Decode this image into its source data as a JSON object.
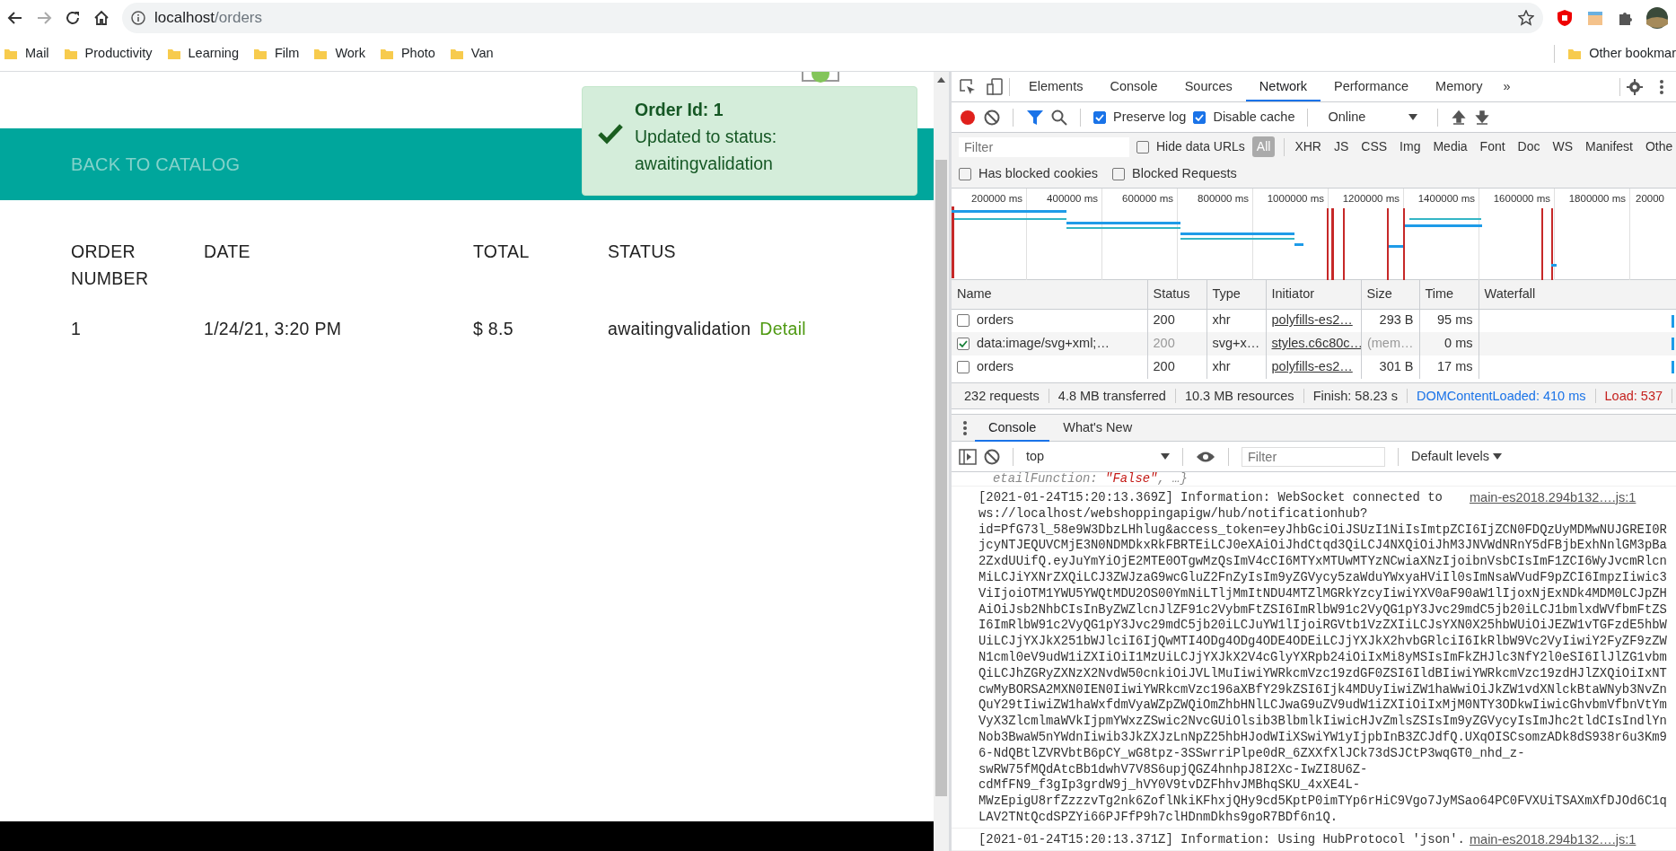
{
  "browser": {
    "url_host": "localhost",
    "url_path": "/orders",
    "bookmarks": [
      "Mail",
      "Productivity",
      "Learning",
      "Film",
      "Work",
      "Photo",
      "Van"
    ],
    "other_bookmarks": "Other bookmar"
  },
  "page": {
    "nav_link": "BACK TO CATALOG",
    "toast": {
      "title": "Order Id: 1",
      "message": "Updated to status: awaitingvalidation"
    },
    "columns": [
      "ORDER NUMBER",
      "DATE",
      "TOTAL",
      "STATUS"
    ],
    "rows": [
      {
        "cells": [
          "1",
          "1/24/21, 3:20 PM",
          "$ 8.5",
          "awaitingvalidation"
        ],
        "action": "Detail"
      }
    ]
  },
  "devtools": {
    "tabs": [
      {
        "label": "Elements",
        "selected": false
      },
      {
        "label": "Console",
        "selected": false
      },
      {
        "label": "Sources",
        "selected": false
      },
      {
        "label": "Network",
        "selected": true
      },
      {
        "label": "Performance",
        "selected": false
      },
      {
        "label": "Memory",
        "selected": false
      }
    ],
    "more_tabs": "»",
    "toolbar": {
      "recording": true,
      "preserve_log": {
        "label": "Preserve log",
        "checked": true
      },
      "disable_cache": {
        "label": "Disable cache",
        "checked": true
      },
      "throttle": "Online"
    },
    "filter": {
      "placeholder": "Filter",
      "hide_data_urls": {
        "label": "Hide data URLs",
        "checked": false
      },
      "types": [
        {
          "label": "All",
          "selected": true
        },
        {
          "label": "XHR",
          "selected": false
        },
        {
          "label": "JS",
          "selected": false
        },
        {
          "label": "CSS",
          "selected": false
        },
        {
          "label": "Img",
          "selected": false
        },
        {
          "label": "Media",
          "selected": false
        },
        {
          "label": "Font",
          "selected": false
        },
        {
          "label": "Doc",
          "selected": false
        },
        {
          "label": "WS",
          "selected": false
        },
        {
          "label": "Manifest",
          "selected": false
        },
        {
          "label": "Othe",
          "selected": false
        }
      ],
      "blocked": [
        {
          "label": "Has blocked cookies",
          "checked": false
        },
        {
          "label": "Blocked Requests",
          "checked": false
        }
      ]
    },
    "overview_ticks": [
      "200000 ms",
      "400000 ms",
      "600000 ms",
      "800000 ms",
      "1000000 ms",
      "1200000 ms",
      "1400000 ms",
      "1600000 ms",
      "1800000 ms",
      "20000"
    ],
    "requests": {
      "columns": [
        "Name",
        "Status",
        "Type",
        "Initiator",
        "Size",
        "Time",
        "Waterfall"
      ],
      "rows": [
        {
          "checked": false,
          "from_cache": false,
          "cells": [
            "orders",
            "200",
            "xhr",
            "polyfills-es2…",
            "293 B",
            "95 ms"
          ]
        },
        {
          "checked": true,
          "from_cache": true,
          "cells": [
            "data:image/svg+xml;…",
            "200",
            "svg+x…",
            "styles.c6c80c…",
            "(mem…",
            "0 ms"
          ]
        },
        {
          "checked": false,
          "from_cache": false,
          "cells": [
            "orders",
            "200",
            "xhr",
            "polyfills-es2…",
            "301 B",
            "17 ms"
          ]
        }
      ]
    },
    "summary": [
      {
        "kind": "plain",
        "text": "232 requests"
      },
      {
        "kind": "plain",
        "text": "4.8 MB transferred"
      },
      {
        "kind": "plain",
        "text": "10.3 MB resources"
      },
      {
        "kind": "plain",
        "text": "Finish: 58.23 s"
      },
      {
        "kind": "dom",
        "text": "DOMContentLoaded: 410 ms"
      },
      {
        "kind": "load",
        "text": "Load: 537"
      }
    ],
    "drawer": {
      "tabs": [
        {
          "label": "Console",
          "selected": true
        },
        {
          "label": "What's New",
          "selected": false
        }
      ],
      "context": "top",
      "filter_placeholder": "Filter",
      "levels": "Default levels"
    },
    "console": [
      {
        "kind": "fragment",
        "key": "etailFunction: ",
        "value": "\"False\"",
        "rest": ", …}"
      },
      {
        "kind": "log",
        "source": "main-es2018.294b132….js:1",
        "lines": [
          "[2021-01-24T15:20:13.369Z] Information: WebSocket connected to",
          "ws://localhost/webshoppingapigw/hub/notificationhub?",
          "id=PfG73l_58e9W3DbzLHhlug&access_token=eyJhbGciOiJSUzI1NiIsImtpZCI6IjZCN0FDQzUyMDMwNUJGREI0R",
          "jcyNTJEQUVCMjE3N0NDMDkxRkFBRTEiLCJ0eXAiOiJhdCtqd3QiLCJ4NXQiOiJhM3JNVWdNRnY5dFBjbExhNnlGM3pBa",
          "2ZxdUUifQ.eyJuYmYiOjE2MTE0OTgwMzQsImV4cCI6MTYxMTUwMTYzNCwiaXNzIjoibnVsbCIsImF1ZCI6WyJvcmRlcn",
          "MiLCJiYXNrZXQiLCJ3ZWJzaG9wcGluZ2FnZyIsIm9yZGVycy5zaWduYWxyaHViIl0sImNsaWVudF9pZCI6ImpzIiwic3",
          "ViIjoiOTM1YWU5YWQtMDU2OS00YmNiLTljMmItNDU4MTZlMGRkYzcyIiwiYXV0aF90aW1lIjoxNjExNDk4MDM0LCJpZH",
          "AiOiJsb2NhbCIsInByZWZlcnJlZF91c2VybmFtZSI6ImRlbW91c2VyQG1pY3Jvc29mdC5jb20iLCJ1bmlxdWVfbmFtZS",
          "I6ImRlbW91c2VyQG1pY3Jvc29mdC5jb20iLCJuYW1lIjoiRGVtb1VzZXIiLCJsYXN0X25hbWUiOiJEZW1vTGFzdE5hbW",
          "UiLCJjYXJkX251bWJlciI6IjQwMTI4ODg4ODg4ODE4ODEiLCJjYXJkX2hvbGRlciI6IkRlbW9Vc2VyIiwiY2FyZF9zZW",
          "N1cml0eV9udW1iZXIiOiI1MzUiLCJjYXJkX2V4cGlyYXRpb24iOiIxMi8yMSIsImFkZHJlc3NfY2l0eSI6IlJlZG1vbm",
          "QiLCJhZGRyZXNzX2NvdW50cnkiOiJVLlMuIiwiYWRkcmVzc19zdGF0ZSI6IldBIiwiYWRkcmVzc19zdHJlZXQiOiIxNT",
          "cwMyBORSA2MXN0IEN0IiwiYWRkcmVzc196aXBfY29kZSI6Ijk4MDUyIiwiZW1haWwiOiJkZW1vdXNlckBtaWNyb3NvZn",
          "QuY29tIiwiZW1haWxfdmVyaWZpZWQiOmZhbHNlLCJwaG9uZV9udW1iZXIiOiIxMjM0NTY3ODkwIiwicGhvbmVfbnVtYm",
          "VyX3ZlcmlmaWVkIjpmYWxzZSwic2NvcGUiOlsib3BlbmlkIiwicHJvZmlsZSIsIm9yZGVycyIsImJhc2tldCIsIndlYn",
          "Nob3BwaW5nYWdnIiwib3JkZXJzLnNpZ25hbHJodWIiXSwiYW1yIjpbInB3ZCJdfQ.UXqOISCsomzADk8dS938r6u3Km9",
          "6-NdQBtlZVRVbtB6pCY_wG8tpz-3SSwrriPlpe0dR_6ZXXfXlJCk73dSJCtP3wqGT0_nhd_z-",
          "swRW75fMQdAtcBb1dwhV7V8S6upjQGZ4hnhpJ8I2Xc-IwZI8U6Z-",
          "cdMfFN9_f3gIp3grdW9j_hVY0V9tvDZFhhvJMBhqSKU_4xXE4L-",
          "MWzEpigU8rfZzzzvTg2nk6ZoflNkiKFhxjQHy9cd5KptP0imTYp6rHiC9Vgo7JyMSao64PC0FVXUiTSAXmXfDJOd6C1q",
          "LAV2TNtQcdSPZYi66PJFfP9h7clHDnmDkhs9goR7BDf6n1Q."
        ]
      },
      {
        "kind": "log",
        "source": "main-es2018.294b132….js:1",
        "lines": [
          "[2021-01-24T15:20:13.371Z] Information: Using HubProtocol 'json'."
        ]
      }
    ]
  }
}
